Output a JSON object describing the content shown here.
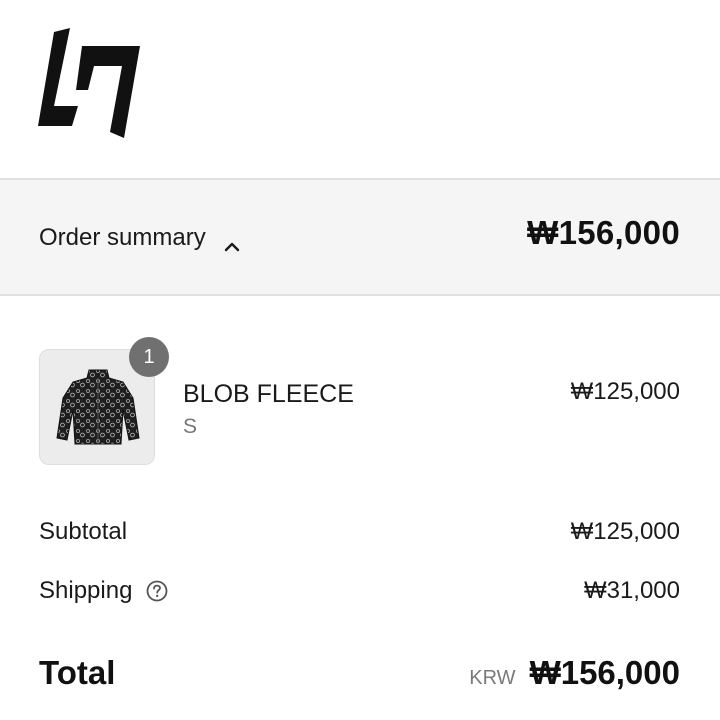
{
  "brand": {
    "logo_icon": "brand-logo-icon"
  },
  "summary": {
    "toggle_label": "Order summary",
    "toggle_icon": "chevron-up-icon",
    "total": "₩156,000"
  },
  "line_items": [
    {
      "quantity": "1",
      "name": "BLOB FLEECE",
      "variant": "S",
      "price": "₩125,000",
      "image_icon": "fleece-jacket-thumbnail"
    }
  ],
  "costs": {
    "subtotal_label": "Subtotal",
    "subtotal_value": "₩125,000",
    "shipping_label": "Shipping",
    "shipping_icon": "question-circle-icon",
    "shipping_value": "₩31,000",
    "total_label": "Total",
    "currency_code": "KRW",
    "total_value": "₩156,000"
  },
  "colors": {
    "summary_bg": "#f5f5f5",
    "badge_bg": "#707070",
    "text": "#1a1a1a",
    "muted": "#777777"
  }
}
